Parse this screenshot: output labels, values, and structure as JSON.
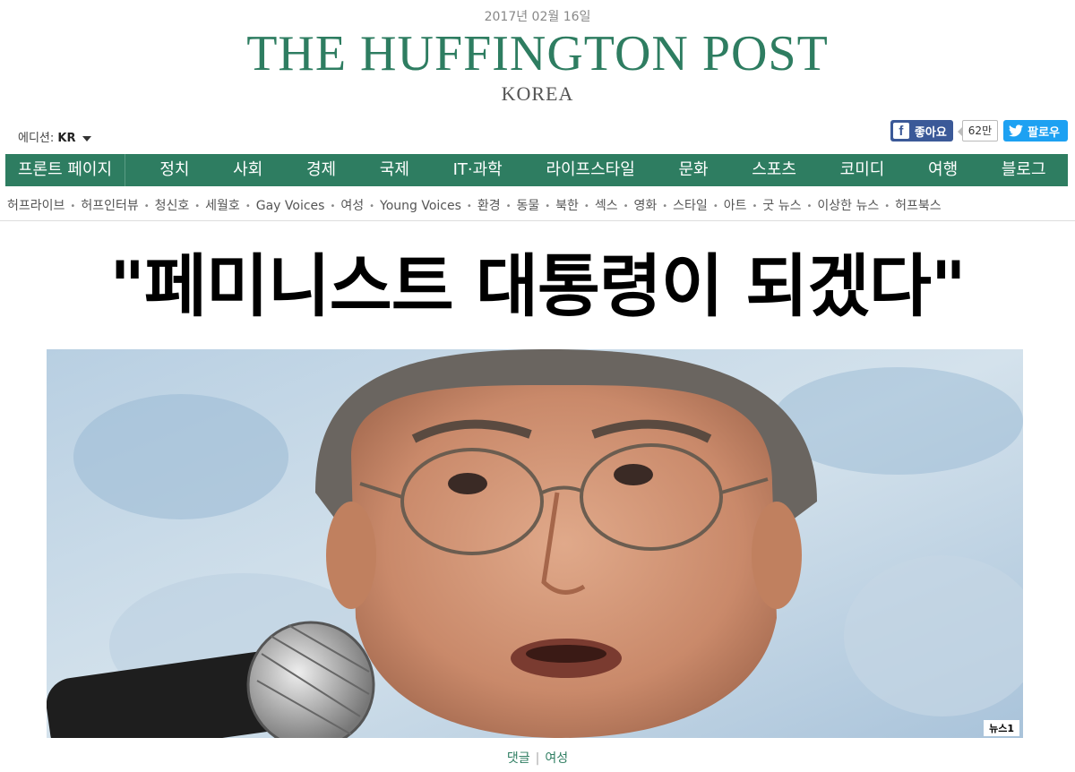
{
  "header": {
    "date": "2017년 02월 16일",
    "logo": "THE HUFFINGTON POST",
    "logo_sub": "KOREA"
  },
  "edition": {
    "label": "에디션:",
    "value": "KR"
  },
  "social": {
    "facebook_label": "좋아요",
    "facebook_count": "62만",
    "twitter_label": "팔로우",
    "facebook_color": "#3b5998",
    "twitter_color": "#1da1f2"
  },
  "main_nav": {
    "front": "프론트 페이지",
    "items": [
      "정치",
      "사회",
      "경제",
      "국제",
      "IT·과학",
      "라이프스타일",
      "문화",
      "스포츠",
      "코미디",
      "여행",
      "블로그"
    ],
    "bg_color": "#2e7d61"
  },
  "sub_nav": {
    "items": [
      "허프라이브",
      "허프인터뷰",
      "청신호",
      "세월호",
      "Gay Voices",
      "여성",
      "Young Voices",
      "환경",
      "동물",
      "북한",
      "섹스",
      "영화",
      "스타일",
      "아트",
      "굿 뉴스",
      "이상한 뉴스",
      "허프북스"
    ]
  },
  "article": {
    "headline": "\"페미니스트 대통령이 되겠다\"",
    "photo_credit": "뉴스1",
    "tags": [
      "댓글",
      "여성"
    ]
  }
}
